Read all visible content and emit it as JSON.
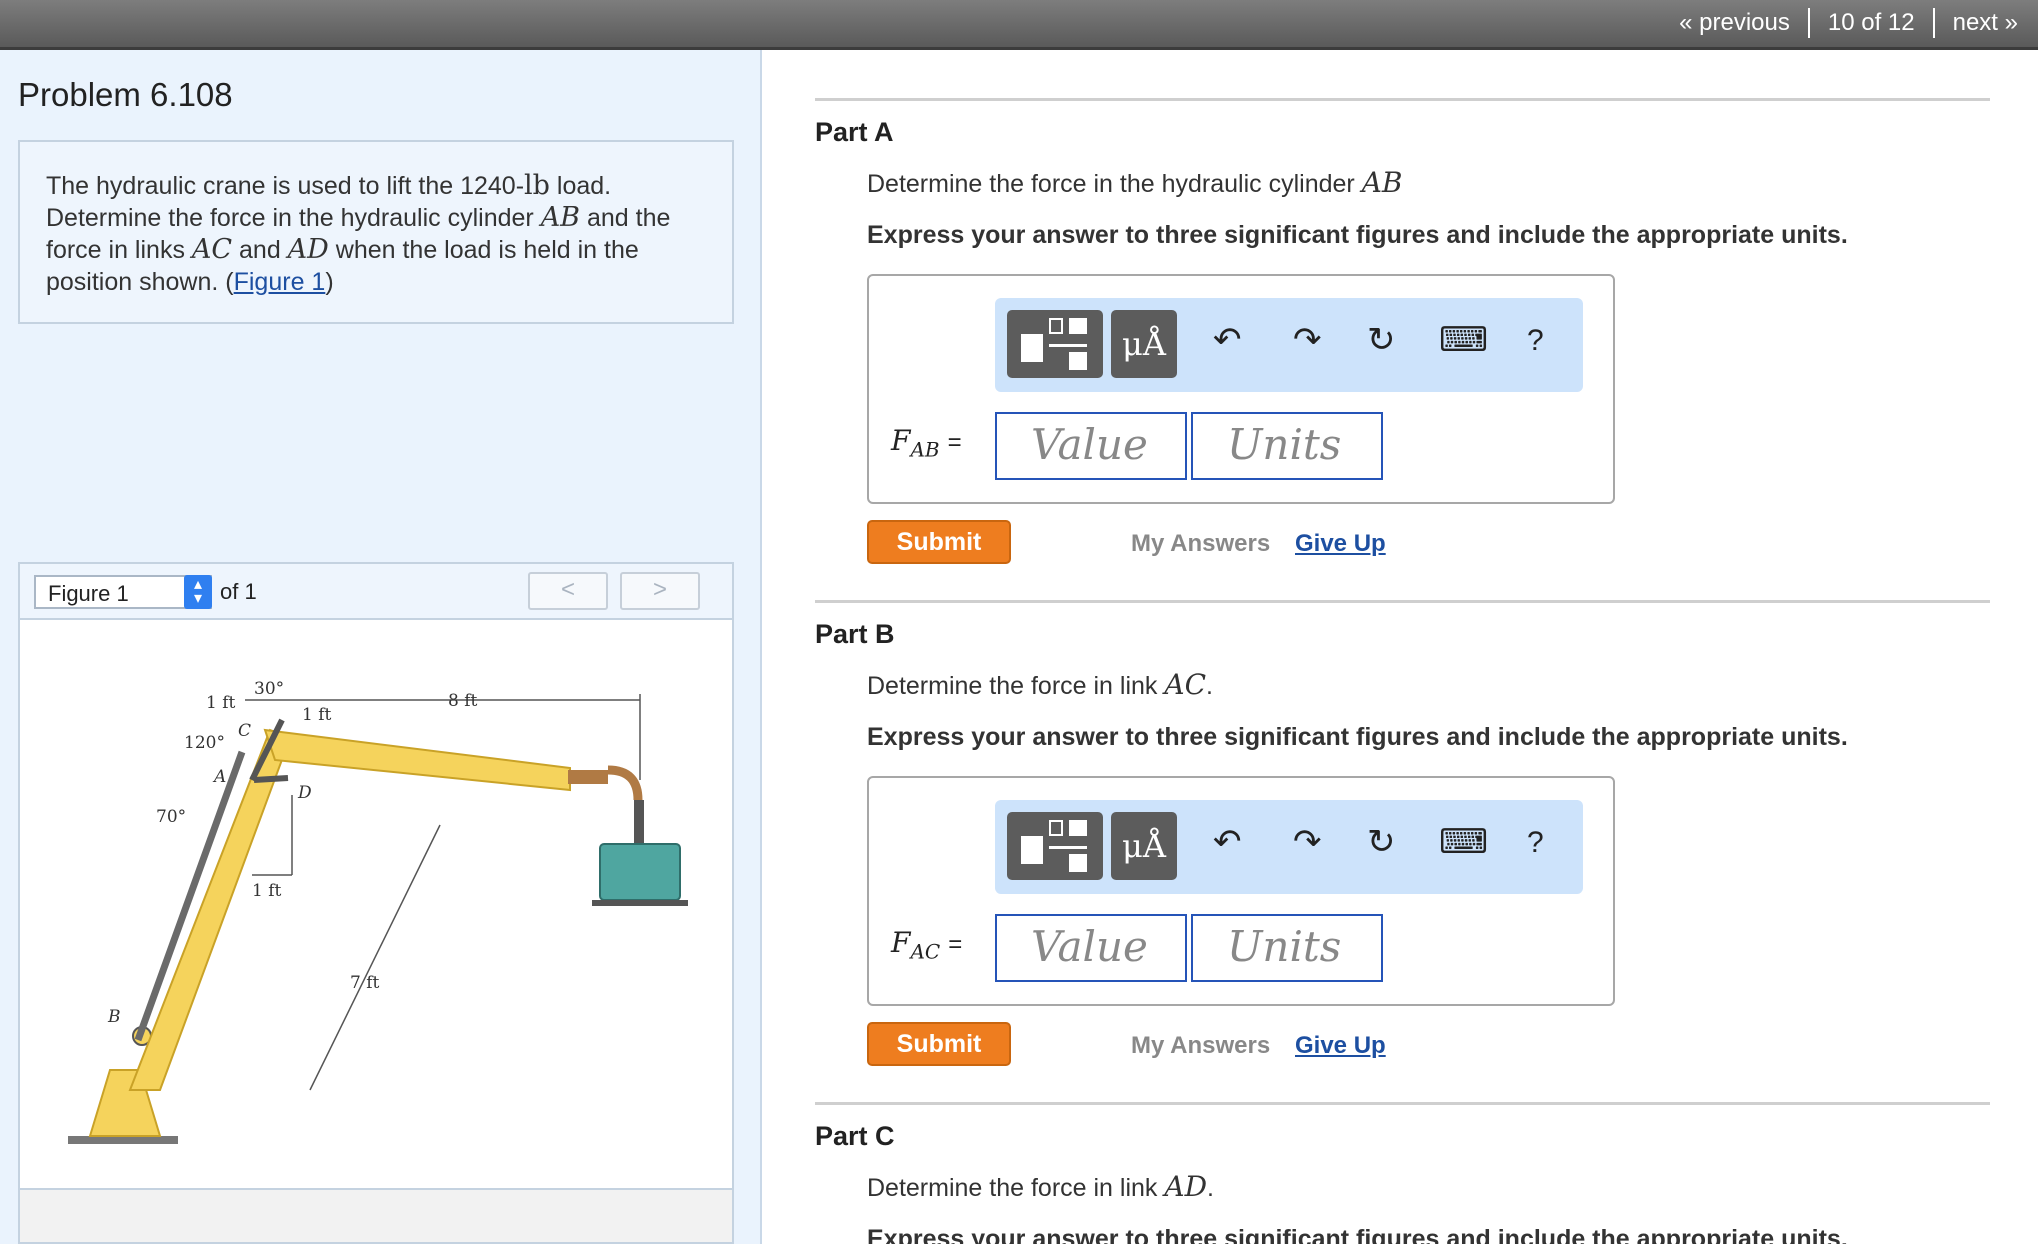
{
  "nav": {
    "previous": "« previous",
    "position": "10 of 12",
    "next": "next »"
  },
  "problem": {
    "title": "Problem 6.108",
    "statement": {
      "t1": "The hydraulic crane is used to lift the 1240-",
      "unit": "lb",
      "t2": " load.",
      "t3": "Determine the force in the hydraulic cylinder ",
      "m1": "AB",
      "t4": " and the",
      "t5": "force in links ",
      "m2": "AC",
      "t6": " and ",
      "m3": "AD",
      "t7": " when the load is held in the",
      "t8": "position shown. (",
      "link": "Figure 1",
      "t9": ")"
    }
  },
  "figure": {
    "selected": "Figure 1",
    "of": "of 1",
    "prev": "<",
    "next": ">",
    "labels": {
      "l30": "30°",
      "l1ft_a": "1 ft",
      "l1ft_b": "1 ft",
      "l8ft": "8 ft",
      "l120": "120°",
      "lC": "C",
      "lA": "A",
      "lD": "D",
      "l70": "70°",
      "l1ft_c": "1 ft",
      "l7ft": "7 ft",
      "lB": "B"
    },
    "colors": {
      "boom": "#f5d35c",
      "boom_dark": "#c9a227",
      "load": "#4fa6a0"
    }
  },
  "parts": [
    {
      "title": "Part A",
      "q": "Determine the force in the hydraulic cylinder ",
      "qm": "AB",
      "qend": "",
      "hint": "Express your answer to three significant figures and include the appropriate units.",
      "var": "F",
      "sub": "AB",
      "eq": "=",
      "value_ph": "Value",
      "units_ph": "Units",
      "submit": "Submit",
      "my_answers": "My Answers",
      "give_up": "Give Up"
    },
    {
      "title": "Part B",
      "q": "Determine the force in link ",
      "qm": "AC",
      "qend": ".",
      "hint": "Express your answer to three significant figures and include the appropriate units.",
      "var": "F",
      "sub": "AC",
      "eq": "=",
      "value_ph": "Value",
      "units_ph": "Units",
      "submit": "Submit",
      "my_answers": "My Answers",
      "give_up": "Give Up"
    },
    {
      "title": "Part C",
      "q": "Determine the force in link ",
      "qm": "AD",
      "qend": ".",
      "hint": "Express your answer to three significant figures and include the appropriate units."
    }
  ],
  "toolbar": {
    "units_symbol": "μÅ",
    "undo": "↶",
    "redo": "↷",
    "reset": "↻",
    "keyboard": "⌨",
    "help": "?"
  }
}
